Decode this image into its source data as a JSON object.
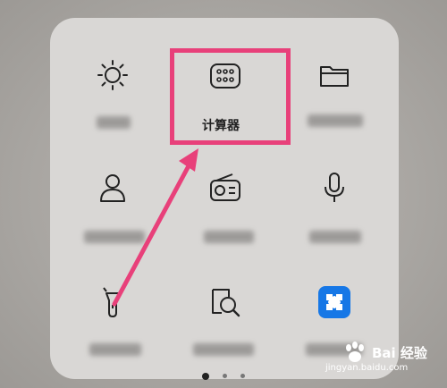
{
  "folder": {
    "apps": [
      {
        "id": "brightness",
        "icon": "sun-icon",
        "label": ""
      },
      {
        "id": "calculator",
        "icon": "calculator-icon",
        "label": "计算器"
      },
      {
        "id": "files",
        "icon": "folder-icon",
        "label": ""
      },
      {
        "id": "contacts",
        "icon": "person-icon",
        "label": ""
      },
      {
        "id": "radio",
        "icon": "radio-icon",
        "label": ""
      },
      {
        "id": "recorder",
        "icon": "microphone-icon",
        "label": ""
      },
      {
        "id": "flashlight",
        "icon": "flashlight-icon",
        "label": ""
      },
      {
        "id": "magnifier",
        "icon": "magnifier-icon",
        "label": ""
      },
      {
        "id": "puzzle",
        "icon": "puzzle-icon",
        "label": ""
      }
    ],
    "page_indicator": {
      "pages": 3,
      "current": 1
    }
  },
  "annotation": {
    "highlight_color": "#e8407a",
    "arrow_color": "#e8407a"
  },
  "watermark": {
    "brand": "Bai 经验",
    "url": "jingyan.baidu.com"
  }
}
